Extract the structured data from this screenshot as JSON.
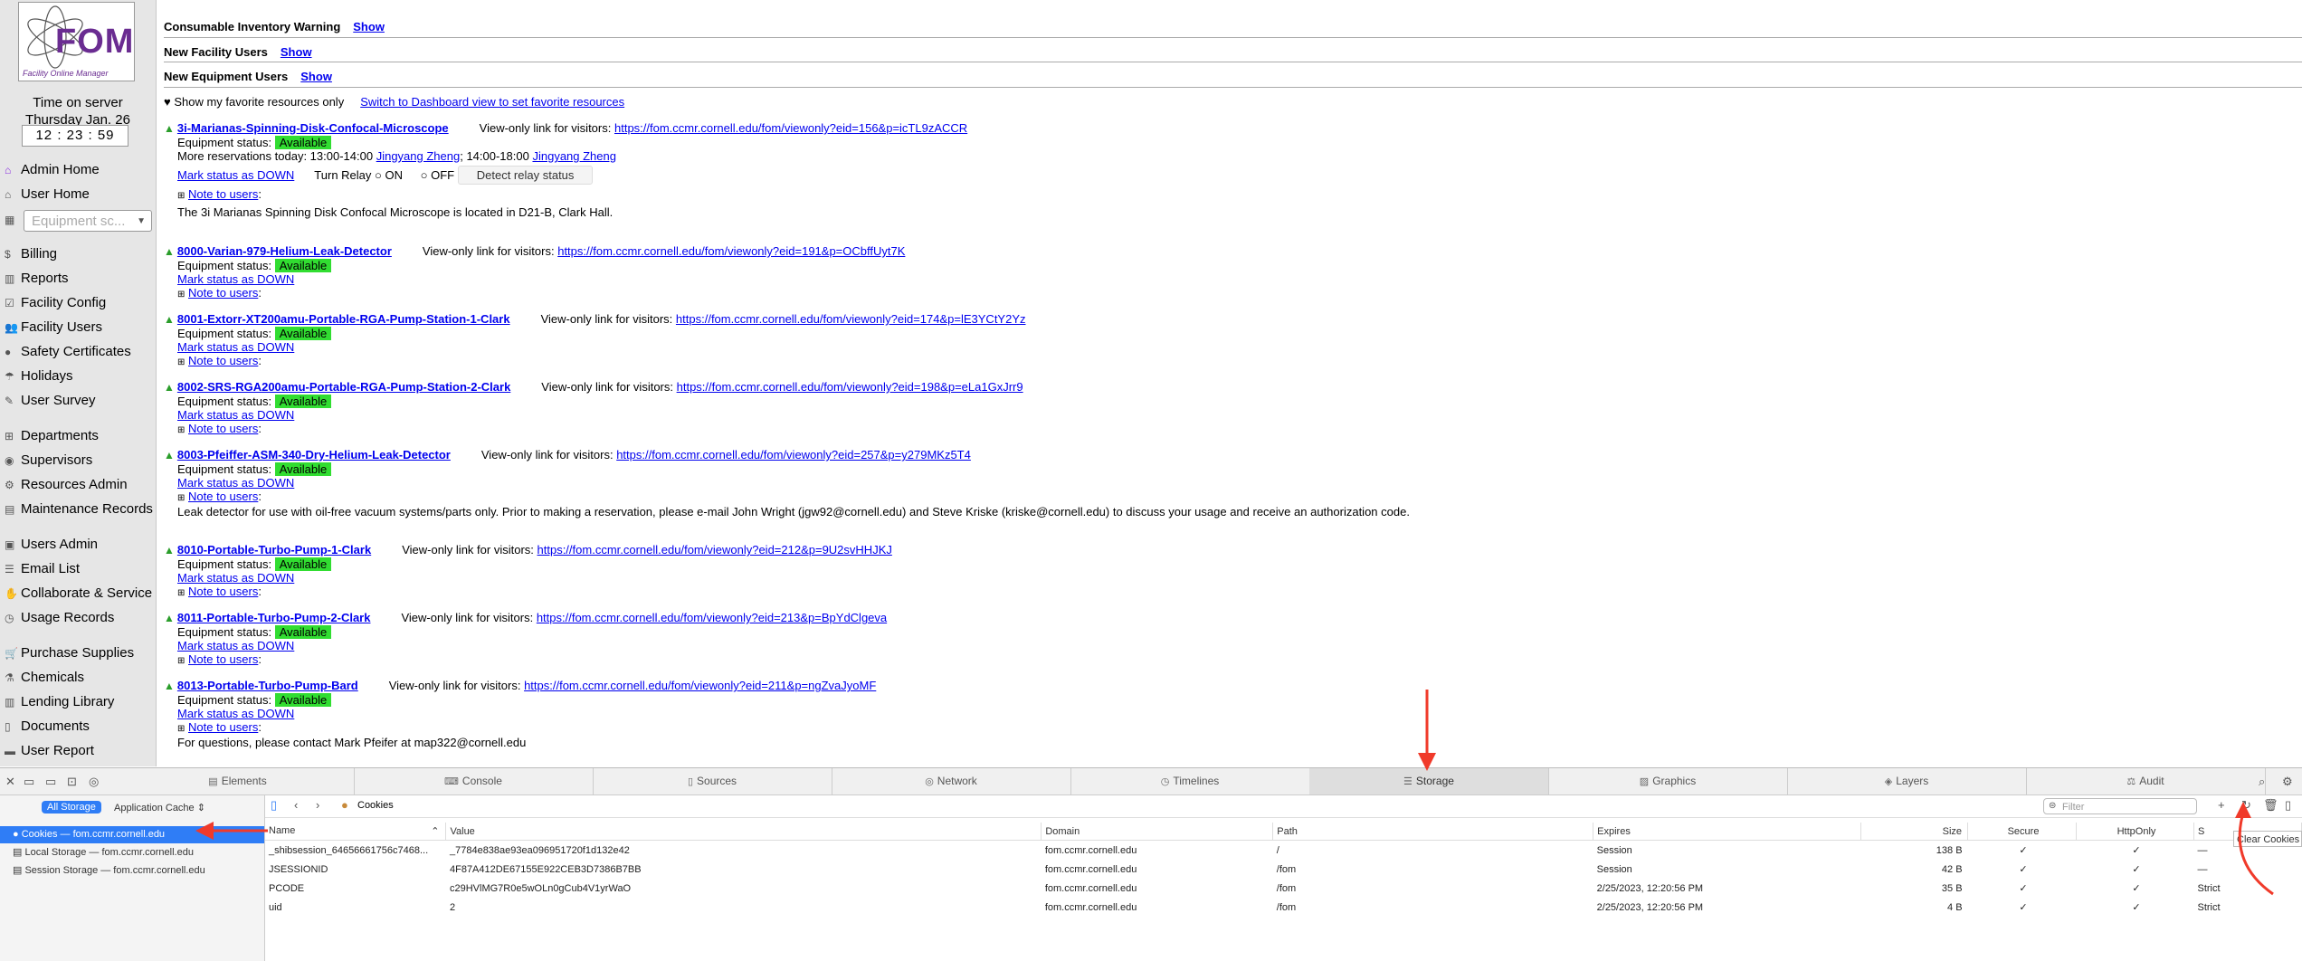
{
  "logo": {
    "title": "FOM",
    "subtitle": "Facility Online Manager"
  },
  "sidebar": {
    "server_time_label": "Time on server",
    "server_date": "Thursday Jan. 26",
    "server_clock": "12 : 23 : 59",
    "equipment_search_placeholder": "Equipment sc...",
    "items": [
      {
        "label": "Admin Home",
        "icon": "home-icon"
      },
      {
        "label": "User Home",
        "icon": "home-icon"
      },
      {
        "label": "Billing",
        "icon": "dollar-icon"
      },
      {
        "label": "Reports",
        "icon": "bar-chart-icon"
      },
      {
        "label": "Facility Config",
        "icon": "checkbox-icon"
      },
      {
        "label": "Facility Users",
        "icon": "users-icon"
      },
      {
        "label": "Safety Certificates",
        "icon": "badge-icon"
      },
      {
        "label": "Holidays",
        "icon": "umbrella-icon"
      },
      {
        "label": "User Survey",
        "icon": "edit-icon"
      },
      {
        "label": "Departments",
        "icon": "sitemap-icon"
      },
      {
        "label": "Supervisors",
        "icon": "user-circle-icon"
      },
      {
        "label": "Resources Admin",
        "icon": "cogs-icon"
      },
      {
        "label": "Maintenance Records",
        "icon": "book-icon"
      },
      {
        "label": "Users Admin",
        "icon": "id-card-icon"
      },
      {
        "label": "Email List",
        "icon": "list-icon"
      },
      {
        "label": "Collaborate & Service",
        "icon": "handshake-icon"
      },
      {
        "label": "Usage Records",
        "icon": "clock-icon"
      },
      {
        "label": "Purchase Supplies",
        "icon": "cart-icon"
      },
      {
        "label": "Chemicals",
        "icon": "flask-icon"
      },
      {
        "label": "Lending Library",
        "icon": "book-open-icon"
      },
      {
        "label": "Documents",
        "icon": "file-icon"
      },
      {
        "label": "User Report",
        "icon": "folder-icon"
      }
    ]
  },
  "headers": [
    {
      "label": "Consumable Inventory Warning",
      "link": "Show"
    },
    {
      "label": "New Facility Users",
      "link": "Show"
    },
    {
      "label": "New Equipment Users",
      "link": "Show"
    }
  ],
  "favorites": {
    "label": "Show my favorite resources only",
    "link": "Switch to Dashboard view to set favorite resources"
  },
  "common": {
    "view_only_label": "View-only link for visitors:",
    "equipment_status_label": "Equipment status:",
    "status_available": "Available",
    "mark_down": "Mark status as DOWN",
    "note_to_users": "Note to users",
    "turn_relay": "Turn Relay",
    "on": "ON",
    "off": "OFF",
    "detect_relay": "Detect relay status"
  },
  "resources": [
    {
      "name": "3i-Marianas-Spinning-Disk-Confocal-Microscope",
      "url": "https://fom.ccmr.cornell.edu/fom/viewonly?eid=156&p=icTL9zACCR",
      "more_reservations": "More reservations today: 13:00-14:00",
      "res_user_1": "Jingyang Zheng",
      "res_sep": "; 14:00-18:00",
      "res_user_2": "Jingyang Zheng",
      "note": "The 3i Marianas Spinning Disk Confocal Microscope is located in D21-B, Clark Hall."
    },
    {
      "name": "8000-Varian-979-Helium-Leak-Detector",
      "url": "https://fom.ccmr.cornell.edu/fom/viewonly?eid=191&p=OCbffUyt7K"
    },
    {
      "name": "8001-Extorr-XT200amu-Portable-RGA-Pump-Station-1-Clark",
      "url": "https://fom.ccmr.cornell.edu/fom/viewonly?eid=174&p=lE3YCtY2Yz"
    },
    {
      "name": "8002-SRS-RGA200amu-Portable-RGA-Pump-Station-2-Clark",
      "url": "https://fom.ccmr.cornell.edu/fom/viewonly?eid=198&p=eLa1GxJrr9"
    },
    {
      "name": "8003-Pfeiffer-ASM-340-Dry-Helium-Leak-Detector",
      "url": "https://fom.ccmr.cornell.edu/fom/viewonly?eid=257&p=y279MKz5T4",
      "note": "Leak detector for use with oil-free vacuum systems/parts only. Prior to making a reservation, please e-mail John Wright (jgw92@cornell.edu) and Steve Kriske (kriske@cornell.edu) to discuss your usage and receive an authorization code."
    },
    {
      "name": "8010-Portable-Turbo-Pump-1-Clark",
      "url": "https://fom.ccmr.cornell.edu/fom/viewonly?eid=212&p=9U2svHHJKJ"
    },
    {
      "name": "8011-Portable-Turbo-Pump-2-Clark",
      "url": "https://fom.ccmr.cornell.edu/fom/viewonly?eid=213&p=BpYdClgeva"
    },
    {
      "name": "8013-Portable-Turbo-Pump-Bard",
      "url": "https://fom.ccmr.cornell.edu/fom/viewonly?eid=211&p=ngZvaJyoMF",
      "note": "For questions, please contact Mark Pfeifer at map322@cornell.edu"
    }
  ],
  "devtools": {
    "tabs": [
      {
        "label": "Elements",
        "icon": "elements-icon"
      },
      {
        "label": "Console",
        "icon": "console-icon"
      },
      {
        "label": "Sources",
        "icon": "sources-icon"
      },
      {
        "label": "Network",
        "icon": "network-icon"
      },
      {
        "label": "Timelines",
        "icon": "timelines-icon"
      },
      {
        "label": "Storage",
        "icon": "storage-icon"
      },
      {
        "label": "Graphics",
        "icon": "graphics-icon"
      },
      {
        "label": "Layers",
        "icon": "layers-icon"
      },
      {
        "label": "Audit",
        "icon": "audit-icon"
      }
    ],
    "all_storage": "All Storage",
    "app_cache": "Application Cache",
    "tree": [
      "Cookies — fom.ccmr.cornell.edu",
      "Local Storage — fom.ccmr.cornell.edu",
      "Session Storage — fom.ccmr.cornell.edu"
    ],
    "breadcrumb": "Cookies",
    "filter_placeholder": "Filter",
    "tooltip": "Clear Cookies",
    "columns": [
      "Name",
      "Value",
      "Domain",
      "Path",
      "Expires",
      "Size",
      "Secure",
      "HttpOnly",
      "S"
    ],
    "rows": [
      [
        "_shibsession_64656661756c7468...",
        "_7784e838ae93ea096951720f1d132e42",
        "fom.ccmr.cornell.edu",
        "/",
        "Session",
        "138 B",
        "✓",
        "✓",
        "—"
      ],
      [
        "JSESSIONID",
        "4F87A412DE67155E922CEB3D7386B7BB",
        "fom.ccmr.cornell.edu",
        "/fom",
        "Session",
        "42 B",
        "✓",
        "✓",
        "—"
      ],
      [
        "PCODE",
        "c29HVlMG7R0e5wOLn0gCub4V1yrWaO",
        "fom.ccmr.cornell.edu",
        "/fom",
        "2/25/2023, 12:20:56 PM",
        "35 B",
        "✓",
        "✓",
        "Strict"
      ],
      [
        "uid",
        "2",
        "fom.ccmr.cornell.edu",
        "/fom",
        "2/25/2023, 12:20:56 PM",
        "4 B",
        "✓",
        "✓",
        "Strict"
      ]
    ]
  }
}
